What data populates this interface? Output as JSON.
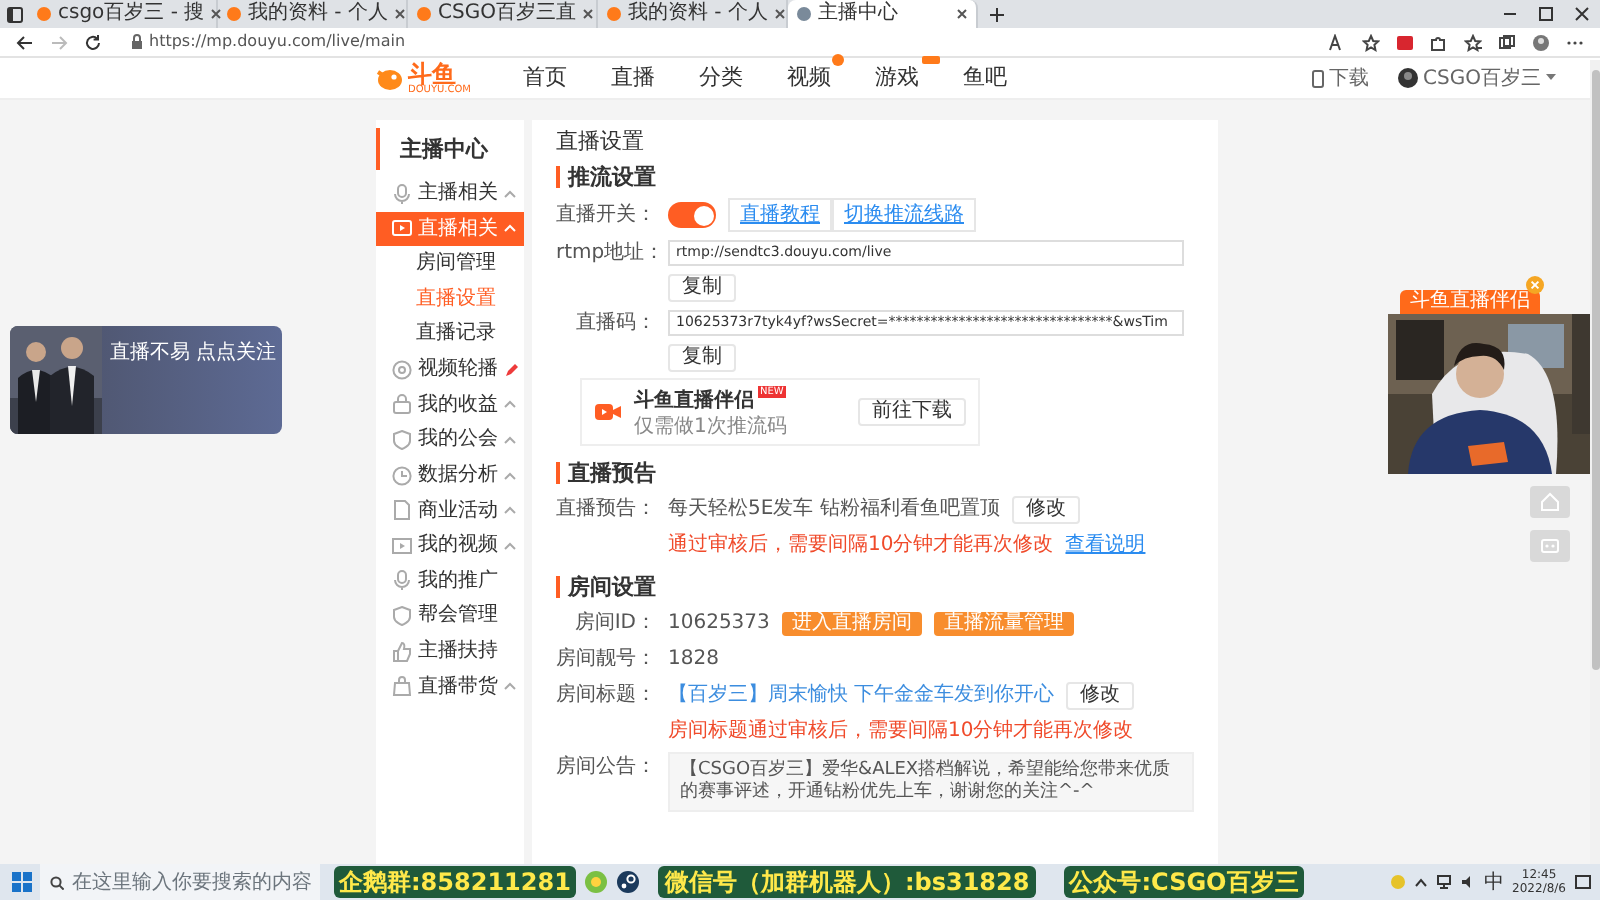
{
  "browser": {
    "tabs": [
      {
        "title": "csgo百岁三 - 搜",
        "selected": false
      },
      {
        "title": "我的资料 - 个人",
        "selected": false
      },
      {
        "title": "CSGO百岁三直",
        "selected": false
      },
      {
        "title": "我的资料 - 个人",
        "selected": false
      },
      {
        "title": "主播中心",
        "selected": true
      }
    ],
    "url": "https://mp.douyu.com/live/main"
  },
  "site_header": {
    "logo_text": "斗鱼",
    "logo_subtext": "DOUYU.COM",
    "nav": [
      {
        "label": "首页"
      },
      {
        "label": "直播"
      },
      {
        "label": "分类"
      },
      {
        "label": "视频",
        "new_dot": true
      },
      {
        "label": "游戏",
        "hot_tag": true
      },
      {
        "label": "鱼吧"
      }
    ],
    "download": "下载",
    "user": "CSGO百岁三"
  },
  "sidebar": {
    "title": "主播中心",
    "items": [
      {
        "label": "主播相关",
        "has_submenu": true,
        "selected": false
      },
      {
        "label": "直播相关",
        "has_submenu": true,
        "selected": true,
        "children": [
          {
            "label": "房间管理",
            "selected": false
          },
          {
            "label": "直播设置",
            "selected": true
          },
          {
            "label": "直播记录",
            "selected": false
          }
        ]
      },
      {
        "label": "视频轮播",
        "has_submenu": false,
        "selected": false,
        "marked": true
      },
      {
        "label": "我的收益",
        "has_submenu": true,
        "selected": false
      },
      {
        "label": "我的公会",
        "has_submenu": true,
        "selected": false
      },
      {
        "label": "数据分析",
        "has_submenu": true,
        "selected": false
      },
      {
        "label": "商业活动",
        "has_submenu": true,
        "selected": false
      },
      {
        "label": "我的视频",
        "has_submenu": true,
        "selected": false
      },
      {
        "label": "我的推广",
        "has_submenu": false,
        "selected": false
      },
      {
        "label": "帮会管理",
        "has_submenu": false,
        "selected": false
      },
      {
        "label": "主播扶持",
        "has_submenu": false,
        "selected": false
      },
      {
        "label": "直播带货",
        "has_submenu": true,
        "selected": false
      }
    ]
  },
  "content": {
    "title": "直播设置",
    "sections": [
      {
        "heading": "推流设置",
        "rows": [
          {
            "kind": "switch",
            "label": "直播开关：",
            "on": true,
            "links": [
              "直播教程",
              "切换推流线路"
            ]
          },
          {
            "kind": "copy_field",
            "label": "rtmp地址：",
            "value": "rtmp://sendtc3.douyu.com/live",
            "button": "复制"
          },
          {
            "kind": "copy_field",
            "label": "直播码：",
            "value": "10625373r7tyk4yf?wsSecret=********************************&wsTim",
            "button": "复制"
          },
          {
            "kind": "promo",
            "title": "斗鱼直播伴侣",
            "badge": "NEW",
            "subtitle": "仅需做1次推流码",
            "button": "前往下载"
          }
        ]
      },
      {
        "heading": "直播预告",
        "rows": [
          {
            "kind": "editable",
            "label": "直播预告：",
            "value": "每天轻松5E发车 钻粉福利看鱼吧置顶",
            "link_value": false,
            "button": "修改",
            "note": "通过审核后，需要间隔10分钟才能再次修改",
            "note_link": "查看说明"
          }
        ]
      },
      {
        "heading": "房间设置",
        "rows": [
          {
            "kind": "id",
            "label": "房间ID：",
            "value": "10625373",
            "buttons": [
              "进入直播房间",
              "直播流量管理"
            ]
          },
          {
            "kind": "text",
            "label": "房间靓号：",
            "value": "1828"
          },
          {
            "kind": "editable",
            "label": "房间标题：",
            "value": "【百岁三】周末愉快 下午金金车发到你开心",
            "link_value": true,
            "button": "修改",
            "note": "房间标题通过审核后，需要间隔10分钟才能再次修改"
          },
          {
            "kind": "textarea",
            "label": "房间公告：",
            "value": "【CSGO百岁三】爱华&ALEX搭档解说，希望能给您带来优质的赛事评述，开通钻粉优先上车，谢谢您的关注^-^"
          }
        ]
      }
    ]
  },
  "overlays": {
    "banner_text": "直播不易 点点关注",
    "companion_tag": "斗鱼直播伴侣"
  },
  "taskbar": {
    "search_placeholder": "在这里输入你要搜索的内容",
    "captions": [
      "企鹅群:858211281",
      "微信号（加群机器人）:bs31828",
      "公众号:CSGO百岁三"
    ],
    "ime": "中",
    "time": "12:45",
    "date": "2022/8/6"
  }
}
